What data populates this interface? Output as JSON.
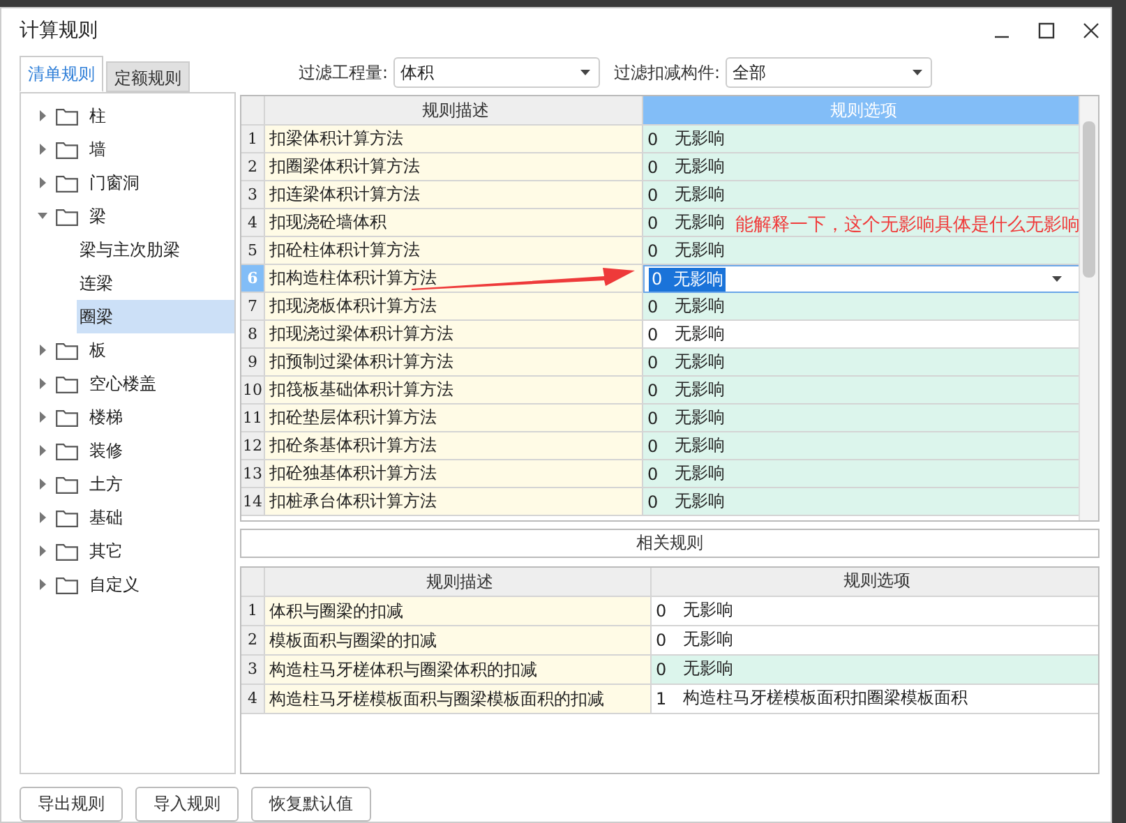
{
  "window": {
    "title": "计算规则"
  },
  "tabs": [
    {
      "label": "清单规则",
      "selected": true
    },
    {
      "label": "定额规则",
      "selected": false
    }
  ],
  "filters": [
    {
      "label": "过滤工程量:",
      "value": "体积"
    },
    {
      "label": "过滤扣减构件:",
      "value": "全部"
    }
  ],
  "tree": [
    {
      "label": "柱",
      "expanded": false,
      "selected": false
    },
    {
      "label": "墙",
      "expanded": false,
      "selected": false
    },
    {
      "label": "门窗洞",
      "expanded": false,
      "selected": false
    },
    {
      "label": "梁",
      "expanded": true,
      "selected": false,
      "children": [
        {
          "label": "梁与主次肋梁",
          "selected": false
        },
        {
          "label": "连梁",
          "selected": false
        },
        {
          "label": "圈梁",
          "selected": true
        }
      ]
    },
    {
      "label": "板",
      "expanded": false,
      "selected": false
    },
    {
      "label": "空心楼盖",
      "expanded": false,
      "selected": false
    },
    {
      "label": "楼梯",
      "expanded": false,
      "selected": false
    },
    {
      "label": "装修",
      "expanded": false,
      "selected": false
    },
    {
      "label": "土方",
      "expanded": false,
      "selected": false
    },
    {
      "label": "基础",
      "expanded": false,
      "selected": false
    },
    {
      "label": "其它",
      "expanded": false,
      "selected": false
    },
    {
      "label": "自定义",
      "expanded": false,
      "selected": false
    }
  ],
  "rules_table": {
    "columns": [
      "规则描述",
      "规则选项"
    ],
    "rows": [
      {
        "index": "1",
        "description": "扣梁体积计算方法",
        "code": "0",
        "option": "无影响",
        "tinted": true,
        "selected": false
      },
      {
        "index": "2",
        "description": "扣圈梁体积计算方法",
        "code": "0",
        "option": "无影响",
        "tinted": true,
        "selected": false
      },
      {
        "index": "3",
        "description": "扣连梁体积计算方法",
        "code": "0",
        "option": "无影响",
        "tinted": true,
        "selected": false
      },
      {
        "index": "4",
        "description": "扣现浇砼墙体积",
        "code": "0",
        "option": "无影响",
        "tinted": true,
        "selected": false
      },
      {
        "index": "5",
        "description": "扣砼柱体积计算方法",
        "code": "0",
        "option": "无影响",
        "tinted": true,
        "selected": false
      },
      {
        "index": "6",
        "description": "扣构造柱体积计算方法",
        "code": "0",
        "option": "无影响",
        "tinted": false,
        "selected": true
      },
      {
        "index": "7",
        "description": "扣现浇板体积计算方法",
        "code": "0",
        "option": "无影响",
        "tinted": true,
        "selected": false
      },
      {
        "index": "8",
        "description": "扣现浇过梁体积计算方法",
        "code": "0",
        "option": "无影响",
        "tinted": false,
        "selected": false
      },
      {
        "index": "9",
        "description": "扣预制过梁体积计算方法",
        "code": "0",
        "option": "无影响",
        "tinted": true,
        "selected": false
      },
      {
        "index": "10",
        "description": "扣筏板基础体积计算方法",
        "code": "0",
        "option": "无影响",
        "tinted": true,
        "selected": false
      },
      {
        "index": "11",
        "description": "扣砼垫层体积计算方法",
        "code": "0",
        "option": "无影响",
        "tinted": true,
        "selected": false
      },
      {
        "index": "12",
        "description": "扣砼条基体积计算方法",
        "code": "0",
        "option": "无影响",
        "tinted": true,
        "selected": false
      },
      {
        "index": "13",
        "description": "扣砼独基体积计算方法",
        "code": "0",
        "option": "无影响",
        "tinted": true,
        "selected": false
      },
      {
        "index": "14",
        "description": "扣桩承台体积计算方法",
        "code": "0",
        "option": "无影响",
        "tinted": true,
        "selected": false
      }
    ]
  },
  "related_button": "相关规则",
  "related_table": {
    "columns": [
      "规则描述",
      "规则选项"
    ],
    "rows": [
      {
        "index": "1",
        "description": "体积与圈梁的扣减",
        "code": "0",
        "option": "无影响",
        "tinted": false
      },
      {
        "index": "2",
        "description": "模板面积与圈梁的扣减",
        "code": "0",
        "option": "无影响",
        "tinted": false
      },
      {
        "index": "3",
        "description": "构造柱马牙槎体积与圈梁体积的扣减",
        "code": "0",
        "option": "无影响",
        "tinted": true
      },
      {
        "index": "4",
        "description": "构造柱马牙槎模板面积与圈梁模板面积的扣减",
        "code": "1",
        "option": "构造柱马牙槎模板面积扣圈梁模板面积",
        "tinted": false
      }
    ]
  },
  "buttons": [
    "导出规则",
    "导入规则",
    "恢复默认值"
  ],
  "annotation": {
    "text": "能解释一下，这个无影响具体是什么无影响"
  }
}
